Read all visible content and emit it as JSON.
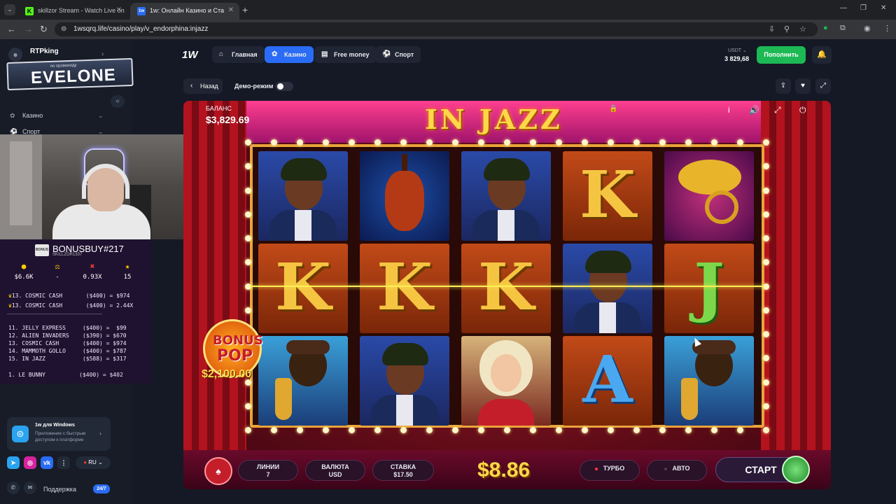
{
  "browser": {
    "tabs": [
      {
        "title": "skillzor Stream - Watch Live on",
        "favicon": "K",
        "active": false
      },
      {
        "title": "1w: Онлайн Казино и Ста",
        "favicon": "1w",
        "active": true
      }
    ],
    "url": "1wsqrq.life/casino/play/v_endorphina:injazz"
  },
  "sidebar": {
    "user_name": "RTPking",
    "promo_small": "по промокоду",
    "promo_code": "EVELONE",
    "items": [
      {
        "label": "Казино",
        "icon": "casino-icon"
      },
      {
        "label": "Спорт",
        "icon": "sport-icon"
      }
    ],
    "windows_promo": {
      "title": "1w для Windows",
      "text": "Приложение с быстрым доступом к платформе"
    },
    "language": "RU",
    "support_label": "Поддержка",
    "support_badge": "24/7"
  },
  "stream_overlay": {
    "title": "BONUSBUY#217",
    "subtitle": "SKILLZOR1337",
    "bonus_icon_text": "BONUS",
    "stats": [
      {
        "icon": "coin",
        "value": "$6.6K"
      },
      {
        "icon": "scale",
        "value": "-"
      },
      {
        "icon": "cross",
        "value": "0.93X"
      },
      {
        "icon": "star",
        "value": "15"
      }
    ],
    "best": [
      "13. COSMIC CASH       ($400) = $974",
      "13. COSMIC CASH       ($400) = 2.44X"
    ],
    "list": [
      "11. JELLY EXPRESS     ($400) =  $99",
      "12. ALIEN INVADERS    ($390) = $670",
      "13. COSMIC CASH       ($400) = $974",
      "14. MAMMOTH GOLLO     ($400) = $787",
      "15. IN JAZZ           ($588) = $317"
    ],
    "next": "1. LE BUNNY          ($400) = $402"
  },
  "header": {
    "logo": "1W",
    "nav": [
      {
        "label": "Главная",
        "icon": "home-icon",
        "active": false
      },
      {
        "label": "Казино",
        "icon": "casino-icon",
        "active": true
      },
      {
        "label": "Free money",
        "icon": "money-icon",
        "active": false
      },
      {
        "label": "Спорт",
        "icon": "sport-icon",
        "active": false
      }
    ],
    "currency": "USDT",
    "balance": "3 829,68",
    "deposit_label": "Пополнить"
  },
  "toolbar": {
    "back_label": "Назад",
    "demo_label": "Демо-режим"
  },
  "game": {
    "title": "IN JAZZ",
    "balance_label": "БАЛАНС",
    "balance_value": "$3,829.69",
    "reels": [
      [
        "bassist",
        "cello",
        "bassist",
        "K",
        "horn"
      ],
      [
        "K",
        "K",
        "K",
        "bassist",
        "J"
      ],
      [
        "sax",
        "bassist",
        "singer",
        "A",
        "sax"
      ]
    ],
    "bonus_pop_line1": "BONUS",
    "bonus_pop_line2": "POP",
    "bonus_pop_amount": "$2,100.00",
    "lines_label": "ЛИНИИ",
    "lines_value": "7",
    "currency_label": "ВАЛЮТА",
    "currency_value": "USD",
    "bet_label": "СТАВКА",
    "bet_value": "$17.50",
    "win_amount": "$8.86",
    "turbo_label": "ТУРБО",
    "auto_label": "АВТО",
    "start_label": "СТАРТ"
  }
}
